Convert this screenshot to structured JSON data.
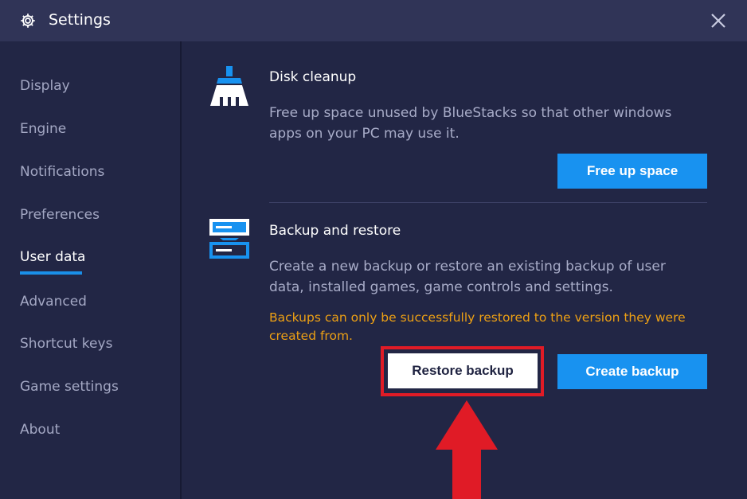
{
  "window": {
    "title": "Settings",
    "icons": {
      "gear": "gear-icon",
      "close": "close-icon"
    }
  },
  "sidebar": {
    "items": [
      {
        "label": "Display",
        "active": false
      },
      {
        "label": "Engine",
        "active": false
      },
      {
        "label": "Notifications",
        "active": false
      },
      {
        "label": "Preferences",
        "active": false
      },
      {
        "label": "User data",
        "active": true
      },
      {
        "label": "Advanced",
        "active": false
      },
      {
        "label": "Shortcut keys",
        "active": false
      },
      {
        "label": "Game settings",
        "active": false
      },
      {
        "label": "About",
        "active": false
      }
    ]
  },
  "disk_cleanup": {
    "icon": "broom-icon",
    "title": "Disk cleanup",
    "description": "Free up space unused by BlueStacks so that other windows apps on your PC may use it.",
    "button_label": "Free up space"
  },
  "backup_restore": {
    "icon": "backup-icon",
    "title": "Backup and restore",
    "description": "Create a new backup or restore an existing backup of user data, installed games, game controls and settings.",
    "warning": "Backups can only be successfully restored to the version they were created from.",
    "restore_label": "Restore backup",
    "create_label": "Create backup"
  },
  "colors": {
    "background": "#222645",
    "titlebar": "#303457",
    "accent": "#1892f0",
    "warning": "#eda014",
    "highlight": "#e01b26"
  }
}
